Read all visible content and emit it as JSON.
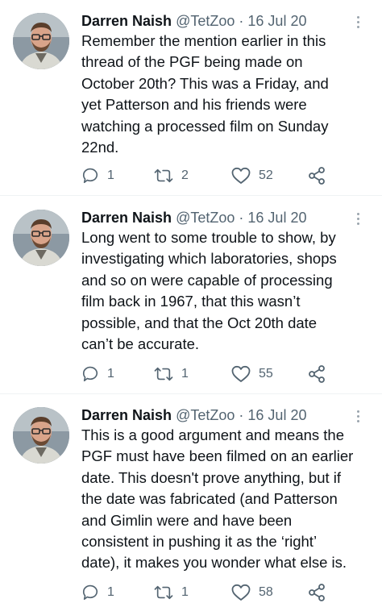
{
  "tweets": [
    {
      "author_name": "Darren Naish",
      "handle": "@TetZoo",
      "separator": "·",
      "date": "16 Jul 20",
      "text": "Remember the mention earlier in this\nthread of the PGF being made on\nOctober 20th? This was a Friday, and\nyet Patterson and his friends were\nwatching a processed film on Sunday\n22nd.",
      "replies": "1",
      "retweets": "2",
      "likes": "52"
    },
    {
      "author_name": "Darren Naish",
      "handle": "@TetZoo",
      "separator": "·",
      "date": "16 Jul 20",
      "text": "Long went to some trouble to show, by\ninvestigating which laboratories, shops\nand so on were capable of processing\nfilm back in 1967, that this wasn’t\npossible, and that the Oct 20th date\ncan’t be accurate.",
      "replies": "1",
      "retweets": "1",
      "likes": "55"
    },
    {
      "author_name": "Darren Naish",
      "handle": "@TetZoo",
      "separator": "·",
      "date": "16 Jul 20",
      "text": "This is a good argument and means the\nPGF must have been filmed on an earlier\ndate. This doesn't prove anything, but if\nthe date was fabricated (and Patterson\nand Gimlin were and have been\nconsistent in pushing it as the ‘right’\ndate), it makes you wonder what else is.",
      "replies": "1",
      "retweets": "1",
      "likes": "58"
    }
  ],
  "icons": {
    "reply": "reply-icon",
    "retweet": "retweet-icon",
    "like": "heart-icon",
    "share": "share-icon",
    "more": "more-options-icon"
  },
  "colors": {
    "text": "#0f1419",
    "secondary": "#536471"
  }
}
